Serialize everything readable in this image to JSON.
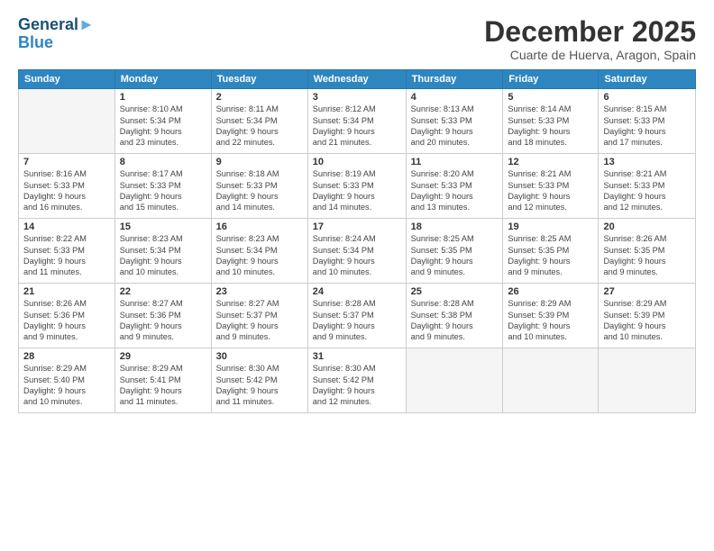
{
  "header": {
    "logo_line1": "General",
    "logo_line2": "Blue",
    "month": "December 2025",
    "location": "Cuarte de Huerva, Aragon, Spain"
  },
  "weekdays": [
    "Sunday",
    "Monday",
    "Tuesday",
    "Wednesday",
    "Thursday",
    "Friday",
    "Saturday"
  ],
  "weeks": [
    [
      {
        "day": "",
        "info": ""
      },
      {
        "day": "1",
        "info": "Sunrise: 8:10 AM\nSunset: 5:34 PM\nDaylight: 9 hours\nand 23 minutes."
      },
      {
        "day": "2",
        "info": "Sunrise: 8:11 AM\nSunset: 5:34 PM\nDaylight: 9 hours\nand 22 minutes."
      },
      {
        "day": "3",
        "info": "Sunrise: 8:12 AM\nSunset: 5:34 PM\nDaylight: 9 hours\nand 21 minutes."
      },
      {
        "day": "4",
        "info": "Sunrise: 8:13 AM\nSunset: 5:33 PM\nDaylight: 9 hours\nand 20 minutes."
      },
      {
        "day": "5",
        "info": "Sunrise: 8:14 AM\nSunset: 5:33 PM\nDaylight: 9 hours\nand 18 minutes."
      },
      {
        "day": "6",
        "info": "Sunrise: 8:15 AM\nSunset: 5:33 PM\nDaylight: 9 hours\nand 17 minutes."
      }
    ],
    [
      {
        "day": "7",
        "info": "Sunrise: 8:16 AM\nSunset: 5:33 PM\nDaylight: 9 hours\nand 16 minutes."
      },
      {
        "day": "8",
        "info": "Sunrise: 8:17 AM\nSunset: 5:33 PM\nDaylight: 9 hours\nand 15 minutes."
      },
      {
        "day": "9",
        "info": "Sunrise: 8:18 AM\nSunset: 5:33 PM\nDaylight: 9 hours\nand 14 minutes."
      },
      {
        "day": "10",
        "info": "Sunrise: 8:19 AM\nSunset: 5:33 PM\nDaylight: 9 hours\nand 14 minutes."
      },
      {
        "day": "11",
        "info": "Sunrise: 8:20 AM\nSunset: 5:33 PM\nDaylight: 9 hours\nand 13 minutes."
      },
      {
        "day": "12",
        "info": "Sunrise: 8:21 AM\nSunset: 5:33 PM\nDaylight: 9 hours\nand 12 minutes."
      },
      {
        "day": "13",
        "info": "Sunrise: 8:21 AM\nSunset: 5:33 PM\nDaylight: 9 hours\nand 12 minutes."
      }
    ],
    [
      {
        "day": "14",
        "info": "Sunrise: 8:22 AM\nSunset: 5:33 PM\nDaylight: 9 hours\nand 11 minutes."
      },
      {
        "day": "15",
        "info": "Sunrise: 8:23 AM\nSunset: 5:34 PM\nDaylight: 9 hours\nand 10 minutes."
      },
      {
        "day": "16",
        "info": "Sunrise: 8:23 AM\nSunset: 5:34 PM\nDaylight: 9 hours\nand 10 minutes."
      },
      {
        "day": "17",
        "info": "Sunrise: 8:24 AM\nSunset: 5:34 PM\nDaylight: 9 hours\nand 10 minutes."
      },
      {
        "day": "18",
        "info": "Sunrise: 8:25 AM\nSunset: 5:35 PM\nDaylight: 9 hours\nand 9 minutes."
      },
      {
        "day": "19",
        "info": "Sunrise: 8:25 AM\nSunset: 5:35 PM\nDaylight: 9 hours\nand 9 minutes."
      },
      {
        "day": "20",
        "info": "Sunrise: 8:26 AM\nSunset: 5:35 PM\nDaylight: 9 hours\nand 9 minutes."
      }
    ],
    [
      {
        "day": "21",
        "info": "Sunrise: 8:26 AM\nSunset: 5:36 PM\nDaylight: 9 hours\nand 9 minutes."
      },
      {
        "day": "22",
        "info": "Sunrise: 8:27 AM\nSunset: 5:36 PM\nDaylight: 9 hours\nand 9 minutes."
      },
      {
        "day": "23",
        "info": "Sunrise: 8:27 AM\nSunset: 5:37 PM\nDaylight: 9 hours\nand 9 minutes."
      },
      {
        "day": "24",
        "info": "Sunrise: 8:28 AM\nSunset: 5:37 PM\nDaylight: 9 hours\nand 9 minutes."
      },
      {
        "day": "25",
        "info": "Sunrise: 8:28 AM\nSunset: 5:38 PM\nDaylight: 9 hours\nand 9 minutes."
      },
      {
        "day": "26",
        "info": "Sunrise: 8:29 AM\nSunset: 5:39 PM\nDaylight: 9 hours\nand 10 minutes."
      },
      {
        "day": "27",
        "info": "Sunrise: 8:29 AM\nSunset: 5:39 PM\nDaylight: 9 hours\nand 10 minutes."
      }
    ],
    [
      {
        "day": "28",
        "info": "Sunrise: 8:29 AM\nSunset: 5:40 PM\nDaylight: 9 hours\nand 10 minutes."
      },
      {
        "day": "29",
        "info": "Sunrise: 8:29 AM\nSunset: 5:41 PM\nDaylight: 9 hours\nand 11 minutes."
      },
      {
        "day": "30",
        "info": "Sunrise: 8:30 AM\nSunset: 5:42 PM\nDaylight: 9 hours\nand 11 minutes."
      },
      {
        "day": "31",
        "info": "Sunrise: 8:30 AM\nSunset: 5:42 PM\nDaylight: 9 hours\nand 12 minutes."
      },
      {
        "day": "",
        "info": ""
      },
      {
        "day": "",
        "info": ""
      },
      {
        "day": "",
        "info": ""
      }
    ]
  ]
}
